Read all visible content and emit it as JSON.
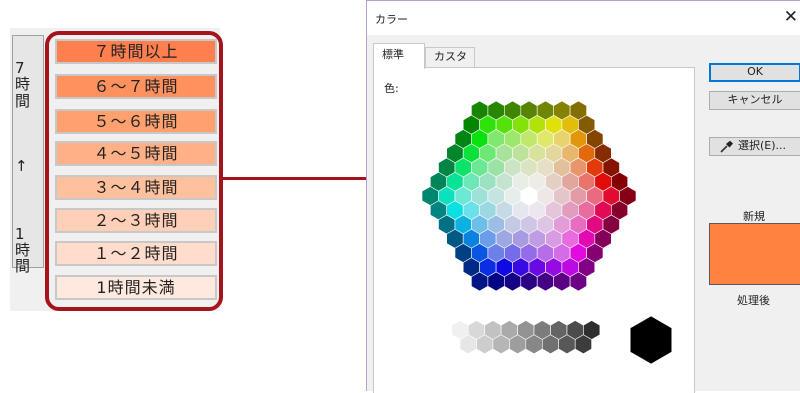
{
  "legend": {
    "top_vertical_label": [
      "7",
      "時",
      "間"
    ],
    "arrow": "↑",
    "bottom_vertical_label": [
      "1",
      "時",
      "間"
    ],
    "bands": [
      {
        "label": "７時間以上",
        "color": "#ff7f4f"
      },
      {
        "label": "６～７時間",
        "color": "#ff915e"
      },
      {
        "label": "５～６時間",
        "color": "#ffa06f"
      },
      {
        "label": "４～５時間",
        "color": "#ffb086"
      },
      {
        "label": "３～４時間",
        "color": "#ffc09e"
      },
      {
        "label": "２～３時間",
        "color": "#ffcfb7"
      },
      {
        "label": "１～２時間",
        "color": "#ffdccb"
      },
      {
        "label": "1時間未満",
        "color": "#ffe9df"
      }
    ],
    "highlight_color": "#a5141c"
  },
  "dialog": {
    "title": "カラー",
    "close_icon": "close-icon",
    "tabs": [
      {
        "label": "標準",
        "active": true
      },
      {
        "label": "カスタム",
        "active": false
      }
    ],
    "color_label": "色:",
    "ok_label": "OK",
    "cancel_label": "キャンセル",
    "pick_label": "選択(E)...",
    "pick_icon": "eyedropper-icon",
    "new_label": "新規",
    "after_label": "処理後",
    "selected_color": "#fe8340"
  }
}
